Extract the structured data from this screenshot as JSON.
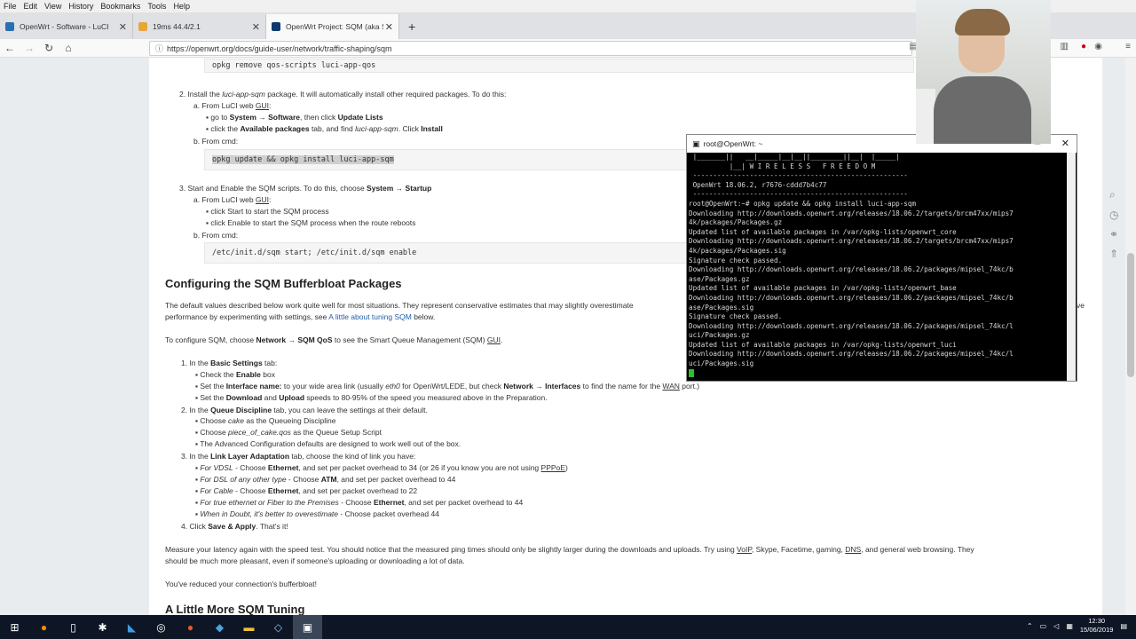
{
  "menubar": [
    "File",
    "Edit",
    "View",
    "History",
    "Bookmarks",
    "Tools",
    "Help"
  ],
  "tabs": [
    {
      "title": "OpenWrt - Software - LuCI",
      "color": "#2a6fb1"
    },
    {
      "title": "19ms 44.4/2.1",
      "color": "#e8a53a"
    },
    {
      "title": "OpenWrt Project: SQM (aka Sm",
      "color": "#0e3a6b"
    }
  ],
  "url": "https://openwrt.org/docs/guide-user/network/traffic-shaping/sqm",
  "doc": {
    "code_remove": "opkg remove qos-scripts luci-app-qos",
    "step2_pre": "2.  Install the ",
    "step2_pkg": "luci-app-sqm",
    "step2_post": " package. It will automatically install other required packages. To do this:",
    "step2a_pre": "a.  From LuCI web ",
    "gui": "GUI",
    "step2a_post": ":",
    "goto_pre": "go to ",
    "system": "System",
    "arrow": " → ",
    "software": "Software",
    "goto_mid": ", then click ",
    "update_lists": "Update Lists",
    "click_pre": "click the ",
    "available_packages": "Available packages",
    "click_mid": " tab, and find ",
    "click_pkg": "luci-app-sqm",
    "click_mid2": ". Click ",
    "install": "Install",
    "step2b": "b.  From cmd:",
    "code_install": "opkg update && opkg install luci-app-sqm",
    "step3_pre": "3.  Start and Enable the SQM scripts. To do this, choose ",
    "startup": "Startup",
    "step3a_pre": "a.  From LuCI web ",
    "click_start": "click Start to start the SQM process",
    "click_enable": "click Enable to start the SQM process when the route reboots",
    "step3b": "b.  From cmd:",
    "code_start": "/etc/init.d/sqm start; /etc/init.d/sqm enable",
    "heading1": "Configuring the SQM Bufferbloat Packages",
    "para1_a": "The default values described below work quite well for most situations. They represent conservative estimates that may slightly overestimate",
    "para1_b_pre": "performance by experimenting with settings, see ",
    "para1_link": "A little about tuning SQM",
    "para1_b_post": " below.",
    "para1_right": "ve",
    "para2_pre": "To configure SQM, choose ",
    "network": "Network",
    "sqm_qos": "SQM QoS",
    "para2_post": " to see the Smart Queue Management (SQM) ",
    "para2_end": ".",
    "l1_pre": "1.  In the ",
    "basic_settings": "Basic Settings",
    "l1_post": " tab:",
    "check_pre": "Check the ",
    "enable": "Enable",
    "check_post": " box",
    "set_pre": "Set the ",
    "interface_name": "Interface name:",
    "set_mid": " to your wide area link (usually ",
    "eth0": "eth0",
    "set_mid2": " for OpenWrt/LEDE, but check ",
    "interfaces": "Interfaces",
    "set_mid3": " to find the name for the ",
    "wan": "WAN",
    "set_post": " port.)",
    "speed_pre": "Set the ",
    "download": "Download",
    "and": " and ",
    "upload": "Upload",
    "speed_post": " speeds to 80-95% of the speed you measured above in the Preparation.",
    "l2_pre": "2.  In the ",
    "queue_discipline": "Queue Discipline",
    "l2_post": " tab, you can leave the settings at their default.",
    "choose1_pre": "Choose ",
    "cake": "cake",
    "choose1_post": " as the Queueing Discipline",
    "piece": "piece_of_cake.qos",
    "choose2_post": " as the Queue Setup Script",
    "advanced": "The Advanced Configuration defaults are designed to work well out of the box.",
    "l3_pre": "3.  In the ",
    "link_layer": "Link Layer Adaptation",
    "l3_post": " tab, choose the kind of link you have:",
    "vdsl": "For VDSL",
    "vdsl_mid": " - Choose ",
    "ethernet": "Ethernet",
    "vdsl_post": ", and set per packet overhead to 34 (or 26 if you know you are not using ",
    "pppoe": "PPPoE",
    "vdsl_end": ")",
    "dsl": "For DSL of any other type",
    "atm": "ATM",
    "dsl_post": ", and set per packet overhead to 44",
    "cable": "For Cable",
    "cable_post": ", and set per packet overhead to 22",
    "fiber": "For true ethernet or Fiber to the Premises",
    "fiber_post": ", and set per packet overhead to 44",
    "doubt": "When in Doubt, it's better to overestimate",
    "doubt_post": " - Choose packet overhead 44",
    "l4_pre": "4.  Click ",
    "save_apply": "Save & Apply",
    "l4_post": ". That's it!",
    "measure_1": "Measure your latency again with the speed test. You should notice that the measured ping times should only be slightly larger during the downloads and uploads. Try using ",
    "voip": "VoIP",
    "measure_mid": ", Skype, Facetime, gaming, ",
    "dns": "DNS",
    "measure_post": ", and general web browsing. They",
    "measure_2": "should be much more pleasant, even if someone's uploading or downloading a lot of data.",
    "reduced": "You've reduced your connection's bufferbloat!",
    "heading2": "A Little More SQM Tuning"
  },
  "terminal": {
    "title": "root@OpenWrt: ~",
    "lines": [
      " |_______||   __|_____|__|__||________||__|  |_____|",
      "          |__| W I R E L E S S   F R E E D O M",
      " -----------------------------------------------------",
      " OpenWrt 18.06.2, r7676-cddd7b4c77",
      " -----------------------------------------------------",
      "root@OpenWrt:~# opkg update && opkg install luci-app-sqm",
      "Downloading http://downloads.openwrt.org/releases/18.06.2/targets/brcm47xx/mips7",
      "4k/packages/Packages.gz",
      "Updated list of available packages in /var/opkg-lists/openwrt_core",
      "Downloading http://downloads.openwrt.org/releases/18.06.2/targets/brcm47xx/mips7",
      "4k/packages/Packages.sig",
      "Signature check passed.",
      "Downloading http://downloads.openwrt.org/releases/18.06.2/packages/mipsel_74kc/b",
      "ase/Packages.gz",
      "Updated list of available packages in /var/opkg-lists/openwrt_base",
      "Downloading http://downloads.openwrt.org/releases/18.06.2/packages/mipsel_74kc/b",
      "ase/Packages.sig",
      "Signature check passed.",
      "Downloading http://downloads.openwrt.org/releases/18.06.2/packages/mipsel_74kc/l",
      "uci/Packages.gz",
      "Updated list of available packages in /var/opkg-lists/openwrt_luci",
      "Downloading http://downloads.openwrt.org/releases/18.06.2/packages/mipsel_74kc/l",
      "uci/Packages.sig"
    ]
  },
  "clock": {
    "time": "12:30",
    "date": "15/06/2019"
  }
}
